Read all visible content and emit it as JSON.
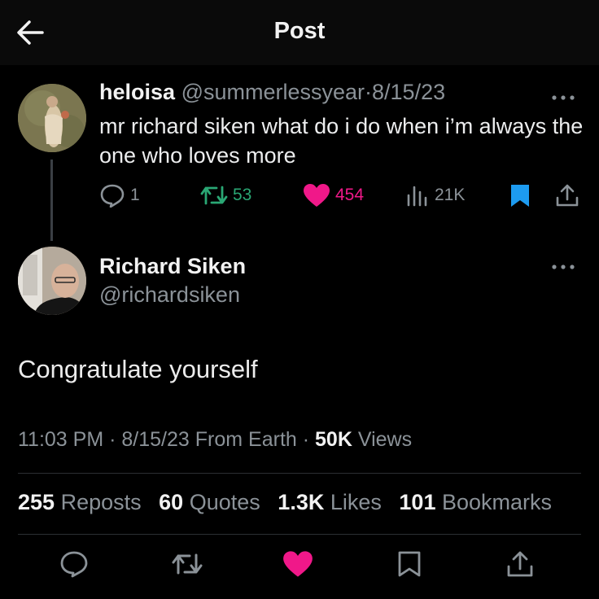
{
  "header": {
    "title": "Post"
  },
  "quoted_post": {
    "name": "heloisa",
    "handle": "@summerlessyear",
    "separator": "·",
    "date": "8/15/23",
    "text": "mr richard siken what do i do when i’m always the one who loves more",
    "stats": {
      "replies": "1",
      "reposts": "53",
      "likes": "454",
      "views": "21K"
    }
  },
  "main_post": {
    "name": "Richard Siken",
    "handle": "@richardsiken",
    "text": "Congratulate yourself",
    "time": "11:03 PM",
    "sep1": "·",
    "date": "8/15/23",
    "from": "From Earth",
    "sep2": "·",
    "views_count": "50K",
    "views_label": "Views"
  },
  "engagement": [
    {
      "count": "255",
      "label": "Reposts"
    },
    {
      "count": "60",
      "label": "Quotes"
    },
    {
      "count": "1.3K",
      "label": "Likes"
    },
    {
      "count": "101",
      "label": "Bookmarks"
    }
  ],
  "colors": {
    "repost": "#2aa774",
    "like": "#f01889",
    "bookmark": "#1d9bf0",
    "muted": "#8b9298"
  },
  "icons": [
    "back-arrow-icon",
    "more-icon",
    "reply-icon",
    "repost-icon",
    "heart-icon",
    "views-icon",
    "bookmark-icon",
    "share-icon"
  ]
}
